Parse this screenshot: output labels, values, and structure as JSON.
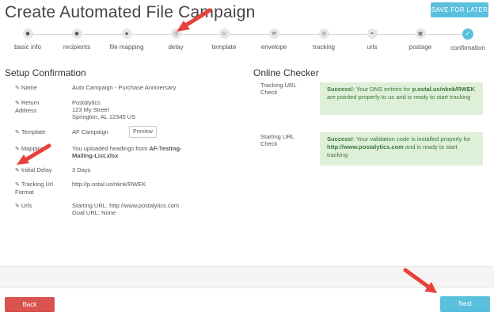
{
  "header": {
    "title": "Create Automated File Campaign",
    "save_label": "SAVE FOR LATER"
  },
  "steps": [
    {
      "label": "basic info",
      "icon": "person-icon",
      "glyph": "●"
    },
    {
      "label": "recipients",
      "icon": "users-icon",
      "glyph": "●"
    },
    {
      "label": "file mapping",
      "icon": "file-icon",
      "glyph": "▪"
    },
    {
      "label": "delay",
      "icon": "clock-icon",
      "glyph": "◷"
    },
    {
      "label": "template",
      "icon": "document-icon",
      "glyph": "▫"
    },
    {
      "label": "envelope",
      "icon": "envelope-icon",
      "glyph": "✉"
    },
    {
      "label": "tracking",
      "icon": "target-icon",
      "glyph": "◎"
    },
    {
      "label": "urls",
      "icon": "link-icon",
      "glyph": "⚭"
    },
    {
      "label": "postage",
      "icon": "stamp-icon",
      "glyph": "▦"
    },
    {
      "label": "confirmation",
      "icon": "check-icon",
      "glyph": "✓"
    }
  ],
  "setup": {
    "heading": "Setup Confirmation",
    "rows": [
      {
        "key": "Name",
        "value": "Auto Campaign - Purchase Anniversary"
      },
      {
        "key": "Return Address",
        "value_lines": [
          "Postalytics",
          "123 My Street",
          "Springton, AL 12345 US"
        ]
      },
      {
        "key": "Template",
        "value": "AF Campaign",
        "button": "Preview"
      },
      {
        "key": "Mapping",
        "value_prefix": "You uploaded headings from ",
        "value_bold": "AF-Testing-Mailing-List.xlsx"
      },
      {
        "key": "Initial Delay",
        "value": "3 Days"
      },
      {
        "key": "Tracking Url Format",
        "value": "http://p.ostal.us/nknk/RWEK"
      },
      {
        "key": "Urls",
        "value_lines": [
          "Starting URL: http://www.postalytics.com",
          "Goal URL: None"
        ]
      }
    ]
  },
  "checker": {
    "heading": "Online Checker",
    "items": [
      {
        "label": "Tracking URL Check",
        "strong1": "Success!",
        "text1": ": Your DNS entries for ",
        "strong2": "p.ostal.us/nknk/RWEK",
        "text2": " are pointed properly to us and is ready to start tracking"
      },
      {
        "label": "Starting URL Check",
        "strong1": "Success!",
        "text1": ": Your validation code is installed properly for ",
        "strong2": "http://www.postalytics.com",
        "text2": " and is ready to start tracking"
      }
    ]
  },
  "footer": {
    "back_label": "Back",
    "next_label": "Next"
  },
  "colors": {
    "accent": "#5bc0de",
    "danger": "#d9534f",
    "success_bg": "#dff0d8",
    "success_text": "#3c763d",
    "annotation_arrow": "#e8413b"
  }
}
